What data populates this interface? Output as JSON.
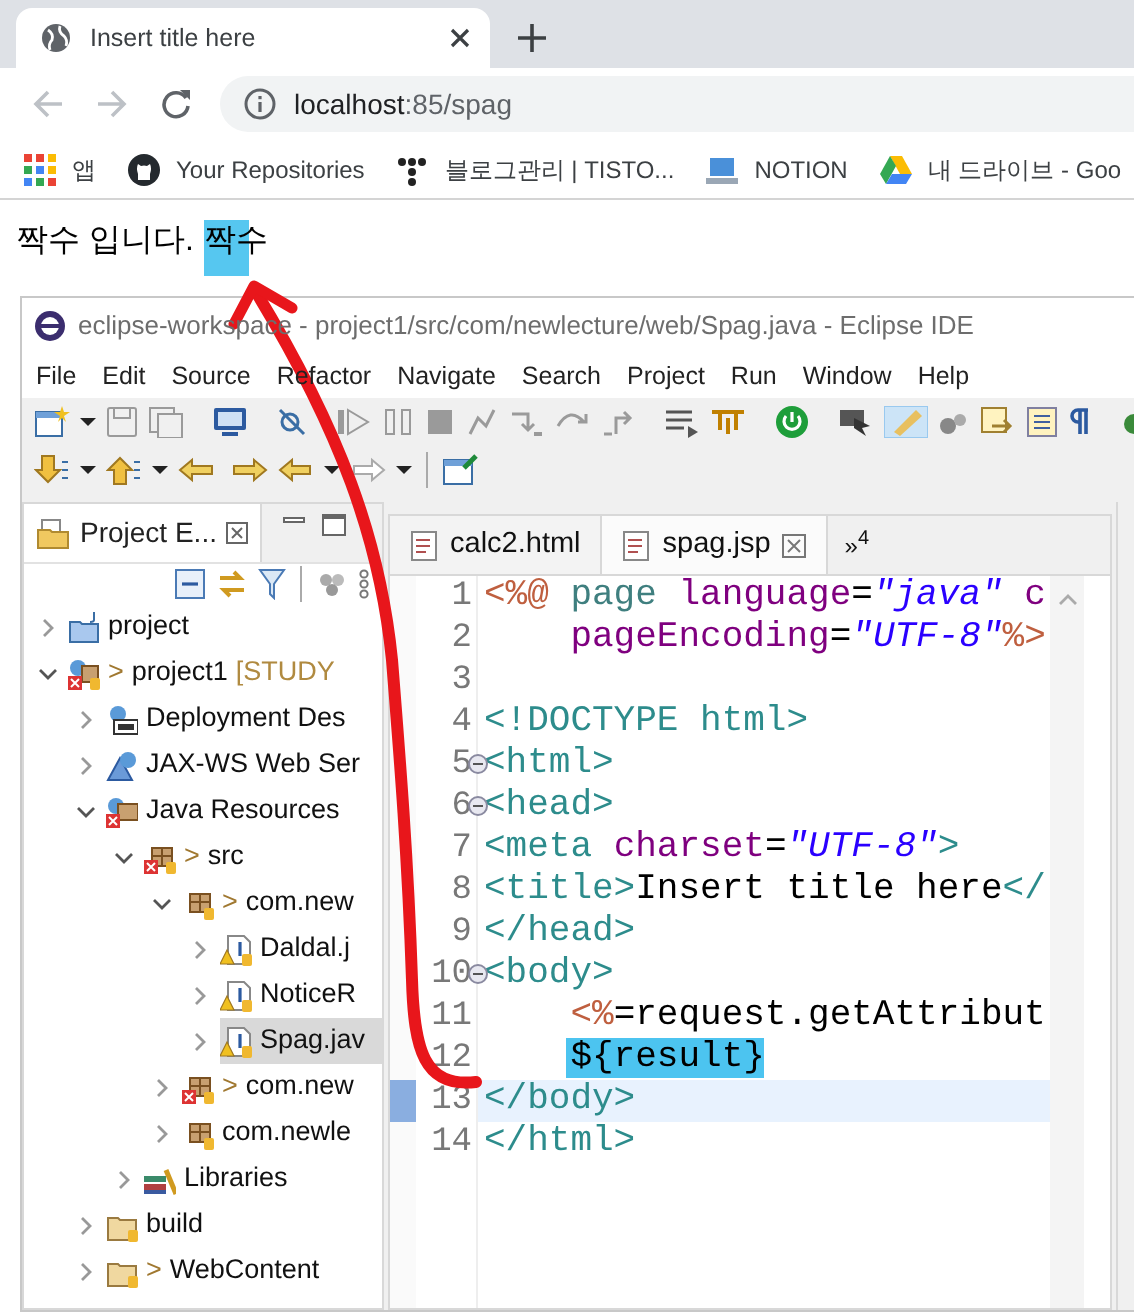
{
  "browser": {
    "tab": {
      "title": "Insert title here"
    },
    "address": {
      "host": "localhost",
      "path": ":85/spag"
    },
    "bookmarks": [
      {
        "kind": "apps",
        "label": "앱"
      },
      {
        "kind": "github",
        "label": "Your Repositories"
      },
      {
        "kind": "dots",
        "label": "블로그관리 | TISTO..."
      },
      {
        "kind": "laptop",
        "label": "NOTION"
      },
      {
        "kind": "drive",
        "label": "내 드라이브 - Goo"
      }
    ],
    "page": {
      "text": "짝수 입니다.",
      "marked_text": "짝수",
      "highlighted": true
    }
  },
  "eclipse": {
    "title": "eclipse-workspace - project1/src/com/newlecture/web/Spag.java - Eclipse IDE",
    "menu": [
      "File",
      "Edit",
      "Source",
      "Refactor",
      "Navigate",
      "Search",
      "Project",
      "Run",
      "Window",
      "Help"
    ],
    "explorer": {
      "title": "Project E...",
      "tree": [
        {
          "kind": "project",
          "label": "project",
          "expanded": false,
          "selected": false
        },
        {
          "kind": "webproject",
          "decorator": ">",
          "label": "project1",
          "suffix": "[STUDY",
          "expanded": true,
          "selected": false,
          "children": [
            {
              "kind": "deployment",
              "label": "Deployment Des",
              "expanded": false,
              "selected": false
            },
            {
              "kind": "webservice",
              "label": "JAX-WS Web Ser",
              "expanded": false,
              "selected": false
            },
            {
              "kind": "resources",
              "label": "Java Resources",
              "expanded": true,
              "selected": false,
              "children": [
                {
                  "kind": "source",
                  "decorator": ">",
                  "label": "src",
                  "expanded": true,
                  "selected": false,
                  "children": [
                    {
                      "kind": "package",
                      "decorator": ">",
                      "label": "com.new",
                      "expanded": true,
                      "selected": false,
                      "children": [
                        {
                          "kind": "javafile",
                          "label": "Daldal.j",
                          "expanded": false,
                          "selected": false
                        },
                        {
                          "kind": "javafile",
                          "label": "NoticeR",
                          "expanded": false,
                          "selected": false
                        },
                        {
                          "kind": "javafile",
                          "label": "Spag.jav",
                          "expanded": false,
                          "selected": true
                        }
                      ]
                    },
                    {
                      "kind": "errorpackage",
                      "decorator": ">",
                      "label": "com.new",
                      "expanded": false,
                      "selected": false
                    },
                    {
                      "kind": "package",
                      "label": "com.newle",
                      "expanded": false,
                      "selected": false
                    }
                  ]
                },
                {
                  "kind": "libraries",
                  "label": "Libraries",
                  "expanded": false,
                  "selected": false
                }
              ]
            },
            {
              "kind": "folder",
              "label": "build",
              "expanded": false,
              "selected": false
            },
            {
              "kind": "folder",
              "decorator": ">",
              "label": "WebContent",
              "expanded": false,
              "selected": false
            }
          ]
        }
      ]
    },
    "editor": {
      "tabs": [
        {
          "label": "calc2.html",
          "selected": false
        },
        {
          "label": "spag.jsp",
          "selected": true
        }
      ],
      "overflow": {
        "chevron": "»",
        "count": "4"
      },
      "lines": [
        {
          "number": "1",
          "fold": false,
          "current": false,
          "tokens": [
            {
              "kind": "directive",
              "text": "<%@"
            },
            {
              "kind": "keyword",
              "text": " page"
            },
            {
              "kind": "attr",
              "text": " language"
            },
            {
              "kind": "plain",
              "text": "="
            },
            {
              "kind": "string",
              "text": "\"java\""
            },
            {
              "kind": "attr",
              "text": " c"
            }
          ]
        },
        {
          "number": "2",
          "fold": false,
          "current": false,
          "tokens": [
            {
              "kind": "attr",
              "text": "    pageEncoding"
            },
            {
              "kind": "plain",
              "text": "="
            },
            {
              "kind": "string",
              "text": "\"UTF-8\""
            },
            {
              "kind": "directive",
              "text": "%>"
            }
          ]
        },
        {
          "number": "3",
          "fold": false,
          "current": false
        },
        {
          "number": "4",
          "fold": false,
          "current": false,
          "tokens": [
            {
              "kind": "tag",
              "text": "<!DOCTYPE html>"
            }
          ]
        },
        {
          "number": "5",
          "fold": true,
          "current": false,
          "tokens": [
            {
              "kind": "tag",
              "text": "<html>"
            }
          ]
        },
        {
          "number": "6",
          "fold": true,
          "current": false,
          "tokens": [
            {
              "kind": "tag",
              "text": "<head>"
            }
          ]
        },
        {
          "number": "7",
          "fold": false,
          "current": false,
          "tokens": [
            {
              "kind": "tag",
              "text": "<meta"
            },
            {
              "kind": "attr",
              "text": " charset"
            },
            {
              "kind": "plain",
              "text": "="
            },
            {
              "kind": "string",
              "text": "\"UTF-8\""
            },
            {
              "kind": "tag",
              "text": ">"
            }
          ]
        },
        {
          "number": "8",
          "fold": false,
          "current": false,
          "tokens": [
            {
              "kind": "tag",
              "text": "<title>"
            },
            {
              "kind": "plain",
              "text": "Insert title here"
            },
            {
              "kind": "tag",
              "text": "</"
            }
          ]
        },
        {
          "number": "9",
          "fold": false,
          "current": false,
          "tokens": [
            {
              "kind": "tag",
              "text": "</head>"
            }
          ]
        },
        {
          "number": "10",
          "fold": true,
          "current": false,
          "tokens": [
            {
              "kind": "tag",
              "text": "<body>"
            }
          ]
        },
        {
          "number": "11",
          "fold": false,
          "current": false,
          "tokens": [
            {
              "kind": "directive",
              "text": "    <%"
            },
            {
              "kind": "plain",
              "text": "=request.getAttribut"
            }
          ]
        },
        {
          "number": "12",
          "fold": false,
          "current": false,
          "indent": true,
          "tokens": [
            {
              "kind": "plain",
              "text": "${result}",
              "highlighted": true
            }
          ]
        },
        {
          "number": "13",
          "fold": false,
          "current": true,
          "tokens": [
            {
              "kind": "tag",
              "text": "</body>"
            }
          ]
        },
        {
          "number": "14",
          "fold": false,
          "current": false,
          "tokens": [
            {
              "kind": "tag",
              "text": "</html>"
            }
          ]
        }
      ]
    }
  }
}
